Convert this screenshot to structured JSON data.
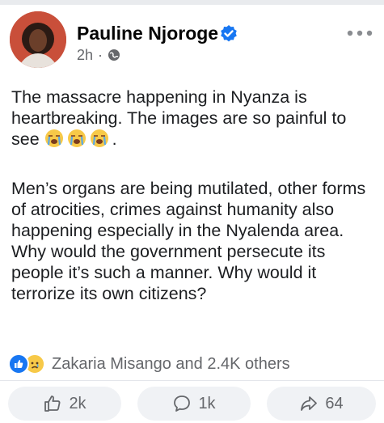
{
  "post": {
    "author": "Pauline Njoroge",
    "time": "2h",
    "separator": "·",
    "paragraph1": "The massacre happening in Nyanza is heartbreaking. The images are so painful to see",
    "paragraph1_end": ".",
    "paragraph2": "Men’s organs are being mutilated, other forms of atrocities, crimes against humanity also happening especially in the Nyalenda area. Why would the government persecute its people it’s such a manner. Why would it terrorize its own citizens?"
  },
  "reactions": {
    "summary": "Zakaria Misango and 2.4K others",
    "icons": [
      "like-icon",
      "sad-icon"
    ]
  },
  "actions": {
    "like_count": "2k",
    "comment_count": "1k",
    "share_count": "64"
  },
  "colors": {
    "accent": "#1877f2",
    "secondary_text": "#65676b",
    "button_bg": "#f0f2f5"
  }
}
